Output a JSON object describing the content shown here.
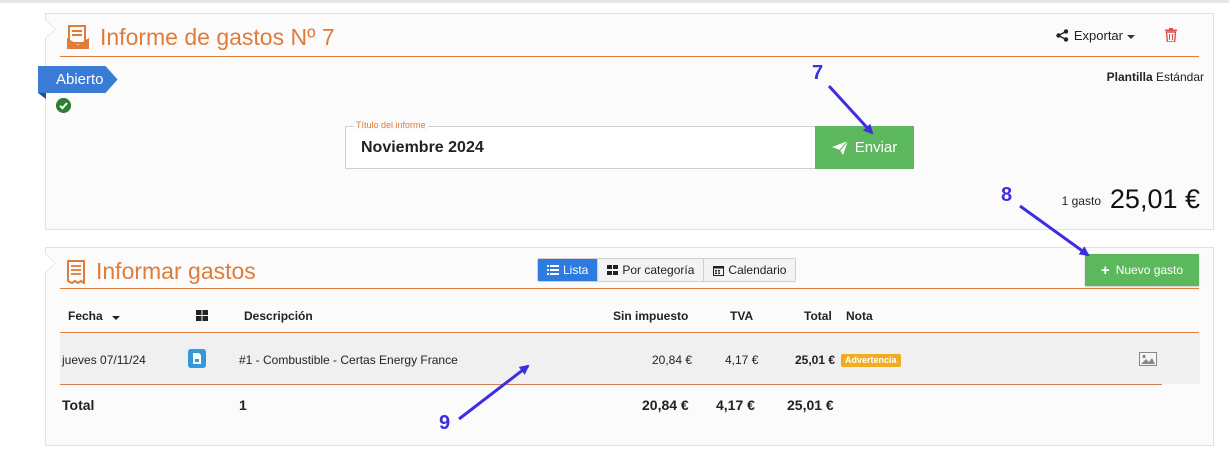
{
  "report": {
    "title": "Informe de gastos Nº 7",
    "export_label": "Exportar",
    "status": "Abierto",
    "template_label": "Plantilla",
    "template_value": "Estándar",
    "field_label": "Título del informe",
    "field_value": "Noviembre 2024",
    "send_label": "Enviar",
    "count": "1 gasto",
    "amount": "25,01 €"
  },
  "expenses": {
    "title": "Informar gastos",
    "views": [
      "Lista",
      "Por categoría",
      "Calendario"
    ],
    "active_view": "Lista",
    "new_label": "Nuevo gasto",
    "headers": {
      "date": "Fecha",
      "description": "Descripción",
      "net": "Sin impuesto",
      "tax": "TVA",
      "total": "Total",
      "note": "Nota"
    },
    "rows": [
      {
        "date": "jueves 07/11/24",
        "description": "#1 - Combustible - Certas Energy France",
        "net": "20,84 €",
        "tax": "4,17 €",
        "total": "25,01 €",
        "badge": "Advertencia"
      }
    ],
    "totals": {
      "label": "Total",
      "count": "1",
      "net": "20,84 €",
      "tax": "4,17 €",
      "total": "25,01 €"
    }
  },
  "annotations": [
    "7",
    "8",
    "9"
  ],
  "colors": {
    "accent": "#e07b39",
    "primary": "#2d7be0",
    "success": "#5cb85c",
    "warning": "#f0ad1f",
    "annotation": "#3d2ee0"
  }
}
